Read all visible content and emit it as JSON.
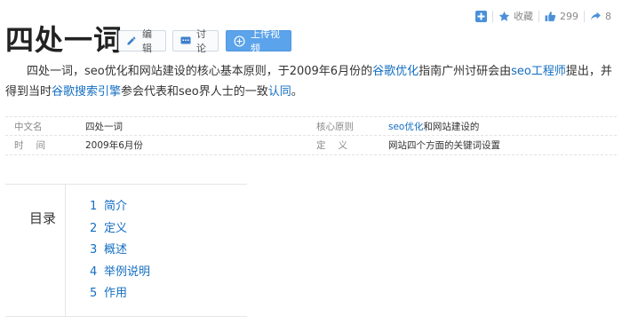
{
  "toolbar": {
    "add_icon": "plus-square-icon",
    "favorite_icon": "star-icon",
    "favorite_label": "收藏",
    "like_icon": "thumbs-up-icon",
    "like_count": "299",
    "share_icon": "share-icon",
    "share_count": "8"
  },
  "entry": {
    "title": "四处一词",
    "edit_label": "编辑",
    "discuss_label": "讨论",
    "upload_label": "上传视频"
  },
  "summary": {
    "t1": "四处一词，seo优化和网站建设的核心基本原则，于2009年6月份的",
    "link1": "谷歌优化",
    "t2": "指南广州讨研会由",
    "link2": "seo工程师",
    "t3": "提出，并得到当时",
    "link3": "谷歌搜索引擎",
    "t4": "参会代表和seo界人士的一致",
    "link4": "认同",
    "t5": "。"
  },
  "basic_info": {
    "rows": [
      {
        "k1": "中文名",
        "v1": "四处一词",
        "k2": "核心原则",
        "v2_link": "seo优化",
        "v2_text": "和网站建设的"
      },
      {
        "k1": "时间",
        "v1": "2009年6月份",
        "k2": "定义",
        "v2_text": "网站四个方面的关键词设置"
      }
    ]
  },
  "catalog": {
    "title": "目录",
    "items": [
      {
        "num": "1",
        "label": "简介"
      },
      {
        "num": "2",
        "label": "定义"
      },
      {
        "num": "3",
        "label": "概述"
      },
      {
        "num": "4",
        "label": "举例说明"
      },
      {
        "num": "5",
        "label": "作用"
      }
    ]
  },
  "colors": {
    "link": "#136ec2",
    "upload_button": "#5ba3ea",
    "toolbar_icon": "#4a90d9"
  }
}
